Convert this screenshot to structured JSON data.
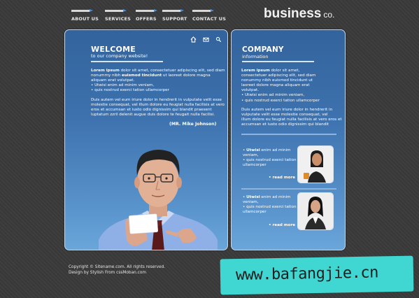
{
  "nav": {
    "items": [
      {
        "label": "ABOUT US"
      },
      {
        "label": "SERVICES"
      },
      {
        "label": "OFFERS"
      },
      {
        "label": "SUPPORT"
      },
      {
        "label": "CONTACT US"
      }
    ]
  },
  "logo": {
    "main": "business",
    "suffix": "co."
  },
  "welcome": {
    "title": "WELCOME",
    "subtitle": "to our company website!",
    "para1_bold": "Lorem ipsum",
    "para1_l1": "dolor sit amet, consectetuer adipiscing elit, sed diam",
    "para1_l2a": "nonummy nibh",
    "para1_l2b": "euismod tincidunt",
    "para1_l2c": "ut laoreet dolore magna",
    "para1_l3": "aliquam erat volutpat.",
    "bullet1": "• Utwisi enim ad minim veniam,",
    "bullet2": "• quis nostrud exerci tation ullamcorper",
    "para2_l1": "Duis autem vel eum iriure dolor in hendrerit in vulputate velit esse",
    "para2_l2": "molestie consequat, vel illum dolore eu feugiat nulla facilisis at vero",
    "para2_l3": "eros et accumsan et iusto odio dignissim qui blandit praesent",
    "para2_l4": "luptatum zzril delenit augue duis dolore te feugait nulla facilisi.",
    "signature": "(MR. Mike Johnson)"
  },
  "company": {
    "title": "COMPANY",
    "subtitle": "information",
    "para1_bold": "Lorem ipsum",
    "para1_l1": "dolor sit amet,",
    "para1_l2": "consectetuer adipiscing elit, sed diam",
    "para1_l3": "nonummy nibh euismod tincidunt ut",
    "para1_l4": "laoreet dolore magna aliquam erat",
    "para1_l5": "volutpat.",
    "bullet1": "• Utwisi enim ad minim veniam,",
    "bullet2": "• quis nostrud exerci tation ullamcorper",
    "para2_l1": "Duis autem vel eum iriure dolor in hendrerit in",
    "para2_l2": "vulputate velit esse molestie consequat, vel",
    "para2_l3": "illum dolore eu feugiat nulla facilisis at vero eros et",
    "para2_l4": "accumsan et iusto odio dignissim qui blandit"
  },
  "news": [
    {
      "bold": "Utwisi",
      "l1": "enim ad minim",
      "l2": "veniam,",
      "l3": "• quis nostrud exerci tation",
      "l4": "ullamcorper",
      "read_more": "read more"
    },
    {
      "bold": "Utwisi",
      "l1": "enim ad minim",
      "l2": "veniam,",
      "l3": "• quis nostrud exerci tation",
      "l4": "ullamcorper",
      "read_more": "read more"
    }
  ],
  "footer": {
    "copyright": "Copyright © Sitename.com. All rights reserved.",
    "design": "Design by Stylish From cssMoban.com"
  },
  "watermark": "www.bafangjie.cn",
  "icons": {
    "home": "home-icon",
    "mail": "mail-icon",
    "search": "search-icon"
  },
  "colors": {
    "panel_top": "#33639c",
    "panel_bottom": "#6aa6da",
    "background": "#3a3a3a",
    "watermark_bg": "#40d6d2",
    "nav_arrow": "#4a90d9"
  }
}
